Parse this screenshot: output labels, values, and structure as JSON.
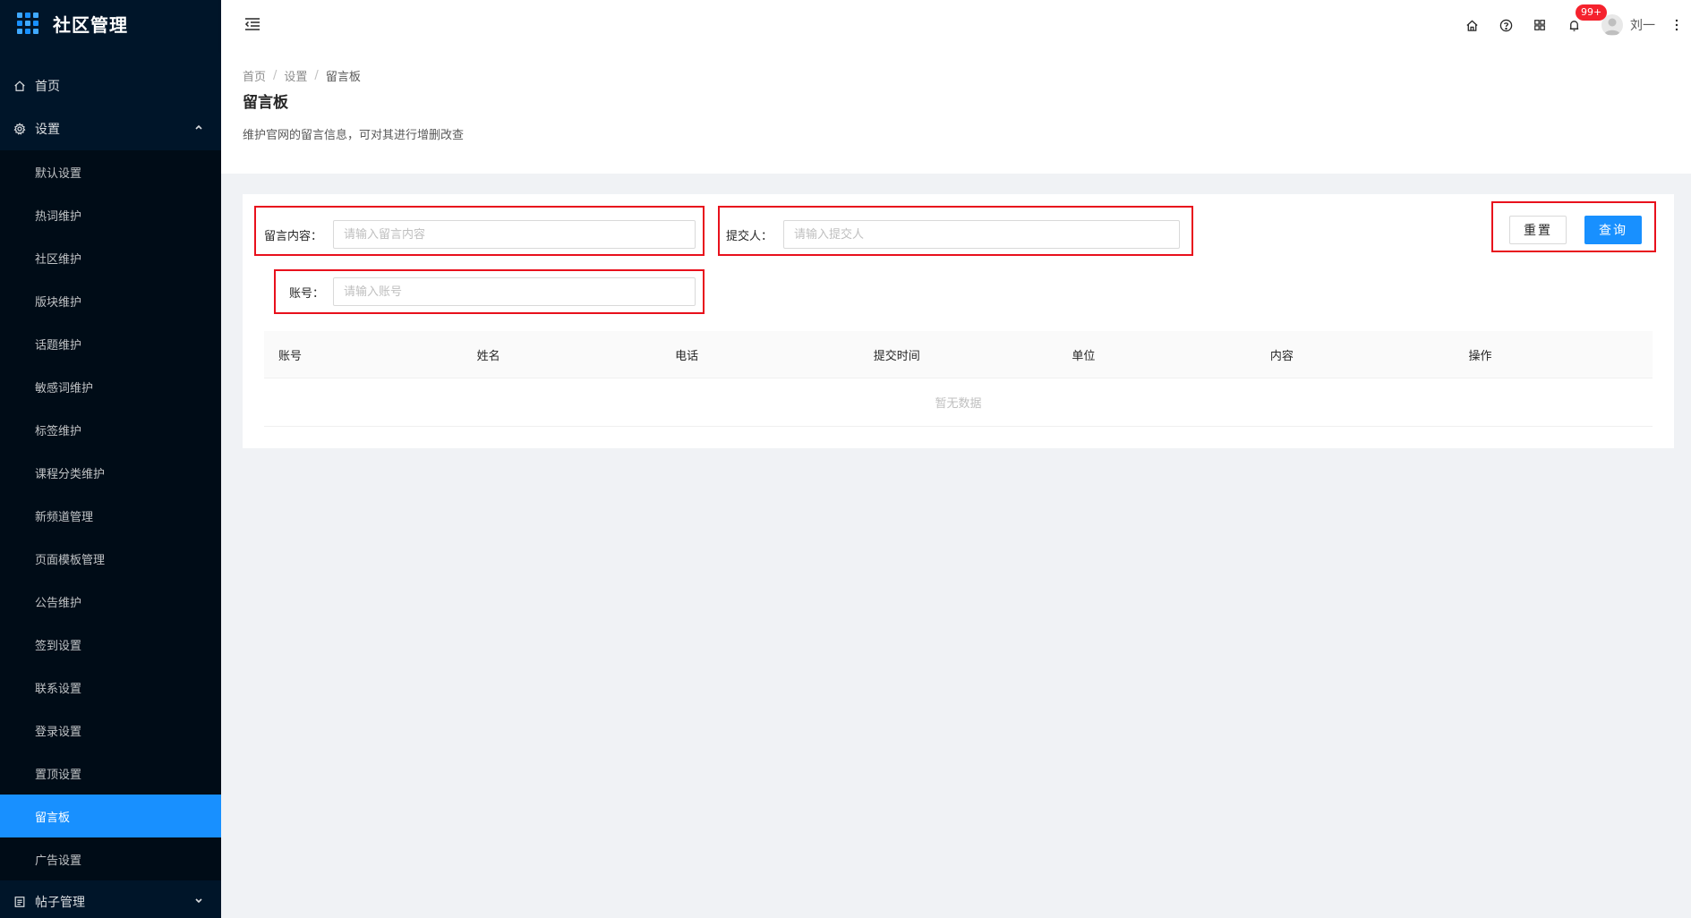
{
  "app": {
    "title": "社区管理"
  },
  "sidebar": {
    "home_label": "首页",
    "settings_label": "设置",
    "settings_items": [
      "默认设置",
      "热词维护",
      "社区维护",
      "版块维护",
      "话题维护",
      "敏感词维护",
      "标签维护",
      "课程分类维护",
      "新频道管理",
      "页面模板管理",
      "公告维护",
      "签到设置",
      "联系设置",
      "登录设置",
      "置顶设置",
      "留言板",
      "广告设置"
    ],
    "active_item": "留言板",
    "posts_label": "帖子管理"
  },
  "header": {
    "notification_badge": "99+",
    "user_name": "刘一"
  },
  "breadcrumb": {
    "home": "首页",
    "parent": "设置",
    "current": "留言板"
  },
  "page": {
    "title": "留言板",
    "description": "维护官网的留言信息，可对其进行增删改查"
  },
  "filters": {
    "content_label": "留言内容：",
    "content_placeholder": "请输入留言内容",
    "submitter_label": "提交人：",
    "submitter_placeholder": "请输入提交人",
    "account_label": "账号：",
    "account_placeholder": "请输入账号",
    "reset_label": "重置",
    "query_label": "查询"
  },
  "table": {
    "columns": [
      "账号",
      "姓名",
      "电话",
      "提交时间",
      "单位",
      "内容",
      "操作"
    ],
    "empty_text": "暂无数据"
  },
  "colors": {
    "primary": "#1890ff",
    "sidebar_bg": "#001529",
    "highlight": "#e8101c"
  }
}
